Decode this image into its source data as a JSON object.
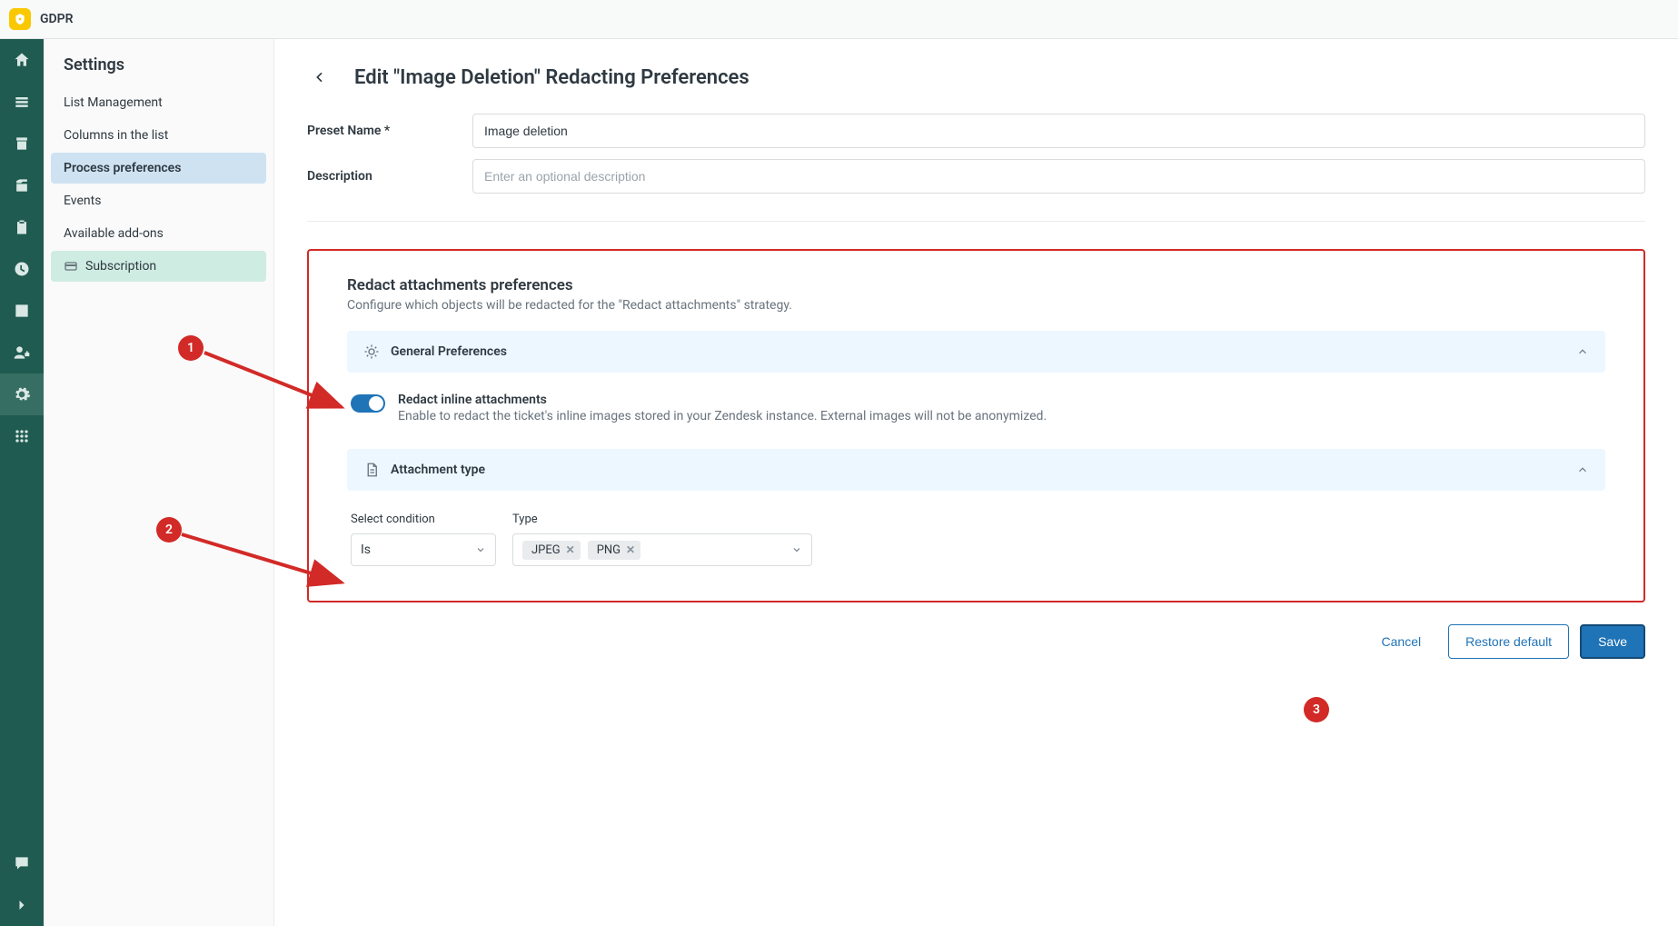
{
  "app": {
    "name": "GDPR"
  },
  "sidebar": {
    "title": "Settings",
    "items": [
      {
        "label": "List Management"
      },
      {
        "label": "Columns in the list"
      },
      {
        "label": "Process preferences"
      },
      {
        "label": "Events"
      },
      {
        "label": "Available add-ons"
      },
      {
        "label": "Subscription"
      }
    ]
  },
  "page": {
    "title": "Edit \"Image Deletion\" Redacting Preferences",
    "preset_label": "Preset Name *",
    "preset_value": "Image deletion",
    "desc_label": "Description",
    "desc_placeholder": "Enter an optional description"
  },
  "redact": {
    "title": "Redact attachments preferences",
    "subtitle": "Configure which objects will be redacted for the \"Redact attachments\" strategy.",
    "general_header": "General Preferences",
    "toggle_label": "Redact inline attachments",
    "toggle_desc": "Enable to redact the ticket's inline images stored in your Zendesk instance. External images will not be anonymized.",
    "attachment_header": "Attachment type",
    "cond_label": "Select condition",
    "cond_value": "Is",
    "type_label": "Type",
    "type_tags": [
      "JPEG",
      "PNG"
    ]
  },
  "footer": {
    "cancel": "Cancel",
    "restore": "Restore default",
    "save": "Save"
  },
  "annotations": {
    "b1": "1",
    "b2": "2",
    "b3": "3"
  }
}
